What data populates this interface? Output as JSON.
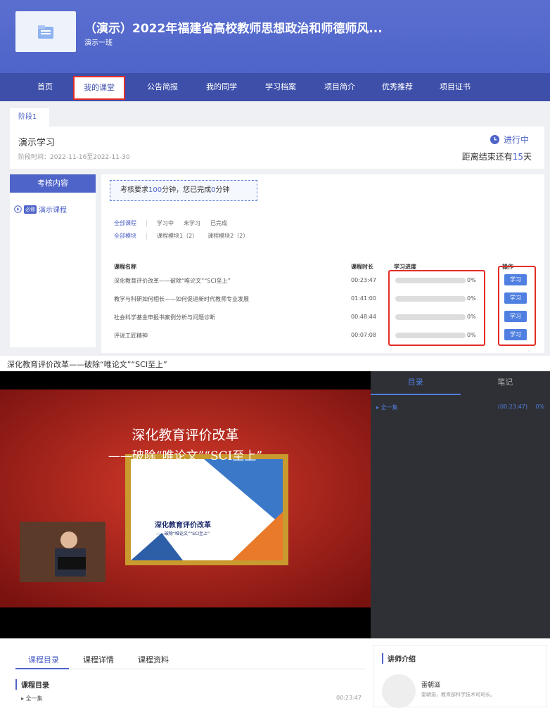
{
  "header": {
    "title": "（演示）2022年福建省高校教师思想政治和师德师风...",
    "subtitle": "演示一班"
  },
  "nav": {
    "items": [
      "首页",
      "我的课堂",
      "公告简报",
      "我的同学",
      "学习档案",
      "项目简介",
      "优秀推荐",
      "项目证书"
    ],
    "active": "我的课堂"
  },
  "stage": {
    "tab": "阶段1",
    "title": "演示学习",
    "period": "阶段时间：2022-11-16至2022-11-30",
    "status": "进行中",
    "remain_prefix": "距离结束还有",
    "remain_days": "15",
    "remain_suffix": "天"
  },
  "left": {
    "header": "考核内容",
    "badge": "必修",
    "item": "演示课程"
  },
  "requirement": {
    "prefix": "考核要求",
    "required": "100",
    "mid": "分钟，您已完成",
    "done": "0",
    "suffix": "分钟"
  },
  "filters": {
    "row1": [
      "全部课程",
      "学习中",
      "未学习",
      "已完成"
    ],
    "row2": [
      "全部模块",
      "课程模块1（2）",
      "课程模块2（2）"
    ]
  },
  "table": {
    "headers": {
      "name": "课程名称",
      "duration": "课程时长",
      "progress": "学习进度",
      "action": "操作"
    },
    "rows": [
      {
        "name": "深化教育评价改革——破除“唯论文”“SCI至上”",
        "duration": "00:23:47",
        "progress": "0%",
        "action": "学习"
      },
      {
        "name": "教学与科研如何相长——如何促进新时代教师专业发展",
        "duration": "01:41:00",
        "progress": "0%",
        "action": "学习"
      },
      {
        "name": "社会科学基金申报书案例分析与问题诊断",
        "duration": "00:48:44",
        "progress": "0%",
        "action": "学习"
      },
      {
        "name": "评说工匠精神",
        "duration": "00:07:08",
        "progress": "0%",
        "action": "学习"
      }
    ]
  },
  "video": {
    "title": "深化教育评价改革——破除“唯论文”“SCI至上”",
    "slide_line1": "深化教育评价改革",
    "slide_line2": "——破除“唯论文”“SCI至上”",
    "frame_line1": "深化教育评价改革",
    "frame_line2": "——破除“唯论文”“SCI至上”"
  },
  "sidebar": {
    "tabs": [
      "目录",
      "笔记"
    ],
    "item": "全一集",
    "item_time": "(00:23:47)",
    "item_pct": "0%"
  },
  "bottom": {
    "tabs": [
      "课程目录",
      "课程详情",
      "课程资料"
    ],
    "catalog_header": "课程目录",
    "catalog_item": "全一集",
    "catalog_time": "00:23:47"
  },
  "lecturer": {
    "header": "讲师介绍",
    "name": "雷朝滋",
    "desc": "雷朝滋，教育部科学技术司司长。"
  },
  "colors": {
    "brand": "#4f64c8",
    "nav": "#3d4fa9",
    "highlight": "#e52d27"
  }
}
